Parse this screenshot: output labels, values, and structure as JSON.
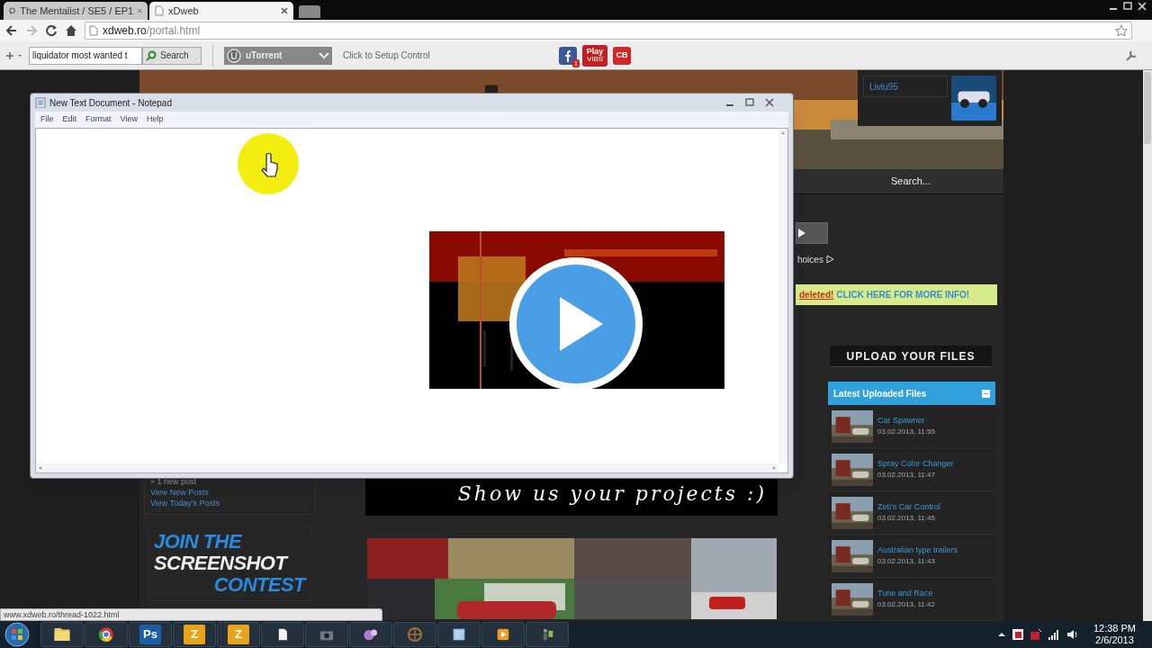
{
  "browser": {
    "tabs": [
      {
        "title": "The Mentalist / SE5 / EP1",
        "selected": false
      },
      {
        "title": "xDweb",
        "selected": true
      }
    ],
    "address": {
      "host": "xdweb.ro",
      "path": "/portal.html"
    },
    "toolbar": {
      "search_value": "liquidator most wanted t",
      "search_button": "Search",
      "dropdown": "uTorrent",
      "setup": "Click to Setup Control"
    },
    "extensions": [
      {
        "kind": "facebook",
        "badge": "1"
      },
      {
        "kind": "play",
        "label": "Play",
        "sub": "VIBS"
      },
      {
        "kind": "cb",
        "label": "CB"
      }
    ]
  },
  "page": {
    "user": "Liviu95",
    "search_placeholder": "Search...",
    "partial_text": "hoices",
    "notice": {
      "alert": "deleted!",
      "link": "CLICK HERE FOR MORE INFO!"
    },
    "forum_links": [
      {
        "kind": "note",
        "text": "» 1 new post"
      },
      {
        "kind": "link",
        "text": "View New Posts"
      },
      {
        "kind": "link",
        "text": "View Today's Posts"
      }
    ],
    "contest_banner": [
      "JOIN THE",
      "SCREENSHOT",
      "CONTEST"
    ],
    "projects_banner": "Show us your projects :)",
    "upload_button": "UPLOAD YOUR FILES",
    "latest": {
      "title": "Latest Uploaded Files",
      "collapse_glyph": "–",
      "items": [
        {
          "name": "Car Spawner",
          "date": "03.02.2013, 11:55"
        },
        {
          "name": "Spray Color Changer",
          "date": "03.02.2013, 11:47"
        },
        {
          "name": "Zeti's Car Control",
          "date": "03.02.2013, 11:45"
        },
        {
          "name": "Australian type trailers",
          "date": "03.02.2013, 11:43"
        },
        {
          "name": "Tune and Race",
          "date": "03.02.2013, 11:42"
        }
      ]
    }
  },
  "notepad": {
    "title": "New Text Document - Notepad",
    "menu": [
      "File",
      "Edit",
      "Format",
      "View",
      "Help"
    ]
  },
  "status_url": "www.xdweb.ro/thread-1022.html",
  "taskbar": {
    "apps": [
      {
        "kind": "folder"
      },
      {
        "kind": "chrome"
      },
      {
        "kind": "letter",
        "label": "Ps",
        "color": "#1c5fa8"
      },
      {
        "kind": "letter",
        "label": "Z",
        "color": "#e8a21c"
      },
      {
        "kind": "letter",
        "label": "Z",
        "color": "#e8a21c"
      },
      {
        "kind": "file"
      },
      {
        "kind": "camera"
      },
      {
        "kind": "bubbles"
      },
      {
        "kind": "wheel"
      },
      {
        "kind": "notepad"
      },
      {
        "kind": "media"
      },
      {
        "kind": "man"
      }
    ],
    "time": "12:38 PM",
    "date": "2/6/2013"
  }
}
